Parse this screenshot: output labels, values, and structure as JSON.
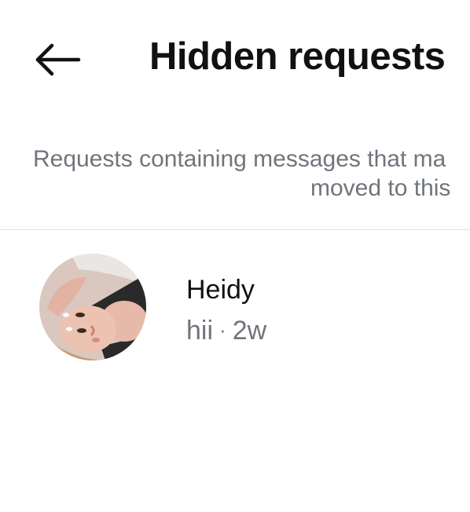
{
  "header": {
    "back_icon": "arrow-left-icon",
    "title": "Hidden requests"
  },
  "notice": {
    "line1": "Requests containing messages that ma",
    "line2": "moved to this"
  },
  "requests": [
    {
      "name": "Heidy",
      "message": "hii",
      "separator": "·",
      "time": "2w"
    }
  ]
}
